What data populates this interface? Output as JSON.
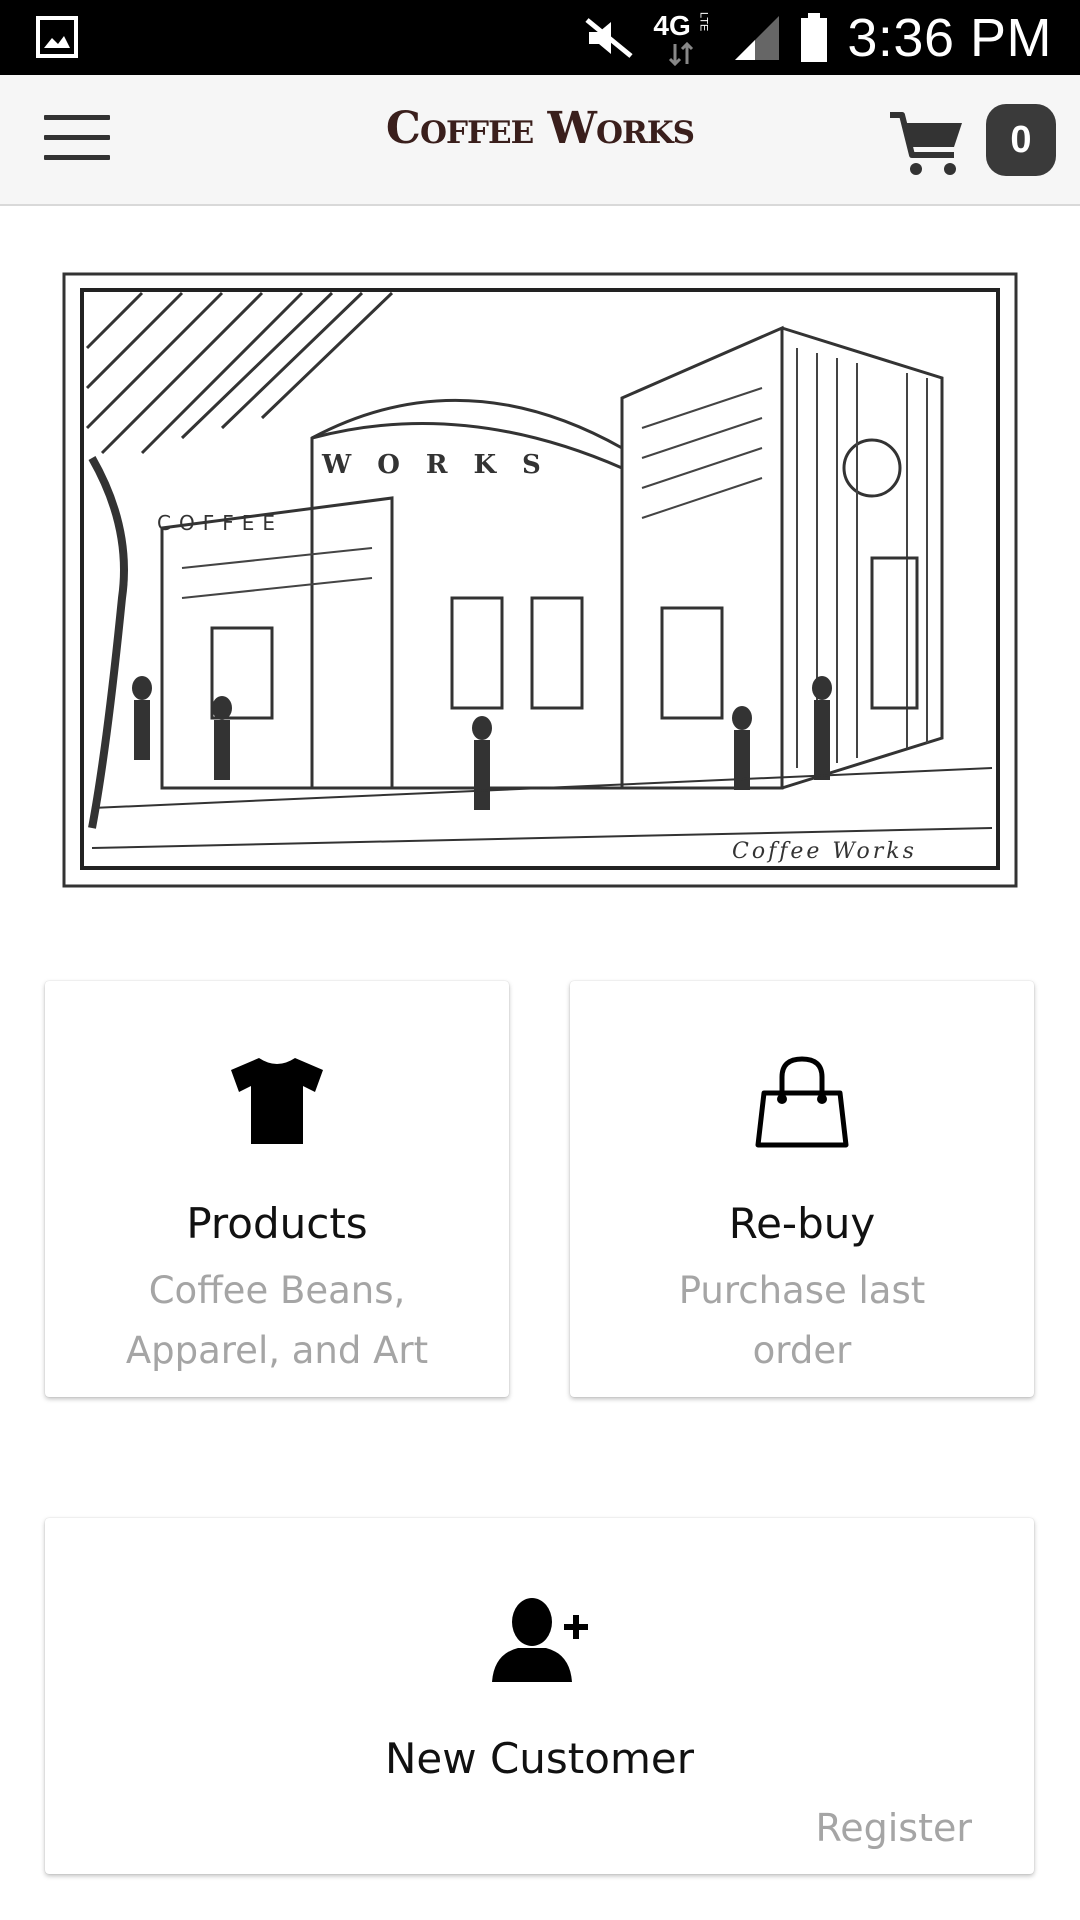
{
  "status_bar": {
    "time": "3:36 PM",
    "network": "4G",
    "network_sub": "LTE"
  },
  "app_bar": {
    "brand": "Coffee Works",
    "cart_count": "0"
  },
  "hero": {
    "image_caption": "Coffee Works",
    "awning_text": "COFFEE",
    "arch_text": "WORKS"
  },
  "cards": {
    "products": {
      "title": "Products",
      "subtitle_line1": "Coffee Beans,",
      "subtitle_line2": "Apparel, and Art",
      "icon": "tshirt-icon"
    },
    "rebuy": {
      "title": "Re-buy",
      "subtitle_line1": "Purchase last",
      "subtitle_line2": "order",
      "icon": "shopping-bag-icon"
    },
    "new_customer": {
      "title": "New Customer",
      "action": "Register",
      "icon": "add-user-icon"
    }
  }
}
